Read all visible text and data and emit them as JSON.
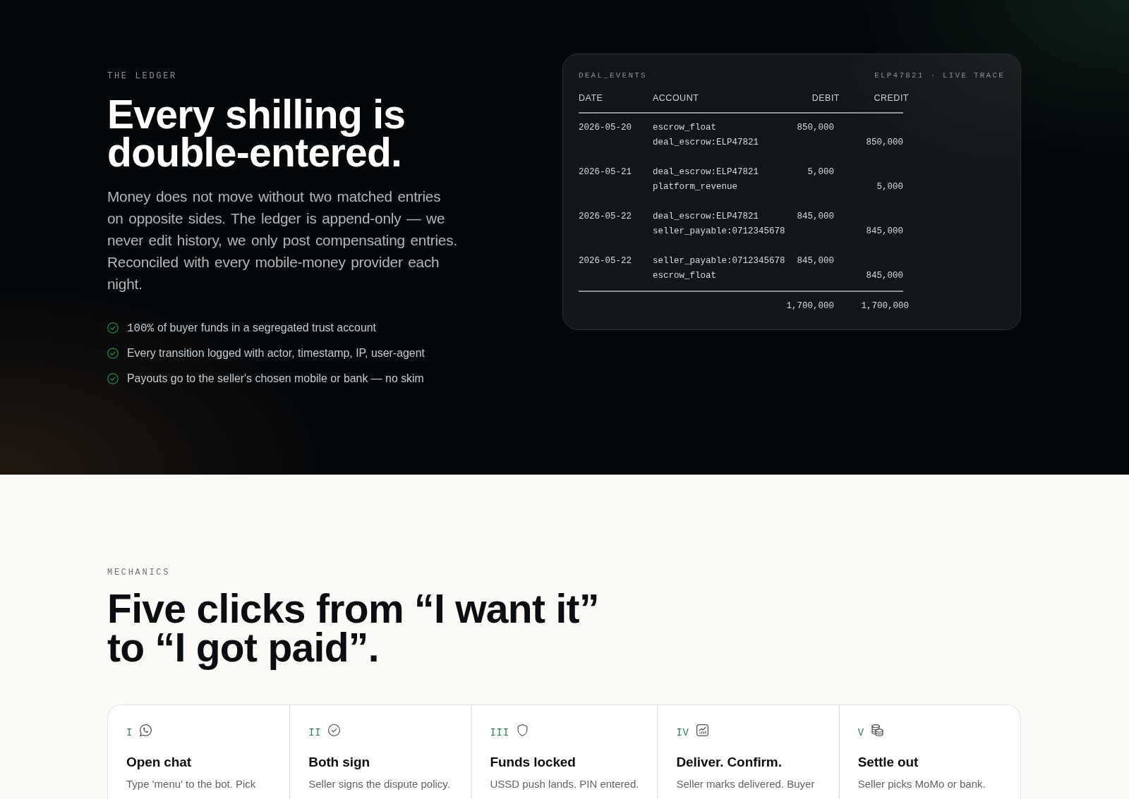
{
  "ledger_section": {
    "eyebrow": "THE LEDGER",
    "heading": "Every shilling is double-entered.",
    "body": "Money does not move without two matched entries on opposite sides. The ledger is append-only — we never edit history, we only post compensating entries. Reconciled with every mobile-money provider each night.",
    "bullets": [
      {
        "lead": "100%",
        "text": "of buyer funds in a segregated trust account"
      },
      {
        "text": "Every transition logged with actor, timestamp, IP, user-agent"
      },
      {
        "text": "Payouts go to the seller's chosen mobile or bank — no skim"
      }
    ]
  },
  "trace_card": {
    "title": "DEAL_EVENTS",
    "trace_label": "ELP47821 · LIVE TRACE",
    "columns": [
      "DATE",
      "ACCOUNT",
      "DEBIT",
      "CREDIT"
    ],
    "entries": [
      {
        "date": "2026-05-20",
        "lines": [
          {
            "account": "escrow_float",
            "debit": "850,000"
          },
          {
            "account": "deal_escrow:ELP47821",
            "credit": "850,000"
          }
        ]
      },
      {
        "date": "2026-05-21",
        "lines": [
          {
            "account": "deal_escrow:ELP47821",
            "debit": "5,000"
          },
          {
            "account": "platform_revenue",
            "credit": "5,000"
          }
        ]
      },
      {
        "date": "2026-05-22",
        "lines": [
          {
            "account": "deal_escrow:ELP47821",
            "debit": "845,000"
          },
          {
            "account": "seller_payable:0712345678",
            "credit": "845,000"
          }
        ]
      },
      {
        "date": "2026-05-22",
        "lines": [
          {
            "account": "seller_payable:0712345678",
            "debit": "845,000"
          },
          {
            "account": "escrow_float",
            "credit": "845,000"
          }
        ]
      }
    ],
    "totals": {
      "debit": "1,700,000",
      "credit": "1,700,000"
    }
  },
  "mechanics_section": {
    "eyebrow": "MECHANICS",
    "heading": "Five clicks from “I want it” to “I got paid”.",
    "steps": [
      {
        "numeral": "I",
        "title": "Open chat",
        "description": "Type 'menu' to the bot. Pick"
      },
      {
        "numeral": "II",
        "title": "Both sign",
        "description": "Seller signs the dispute policy."
      },
      {
        "numeral": "III",
        "title": "Funds locked",
        "description": "USSD push lands. PIN entered."
      },
      {
        "numeral": "IV",
        "title": "Deliver. Confirm.",
        "description": "Seller marks delivered. Buyer"
      },
      {
        "numeral": "V",
        "title": "Settle out",
        "description": "Seller picks MoMo or bank."
      }
    ]
  }
}
